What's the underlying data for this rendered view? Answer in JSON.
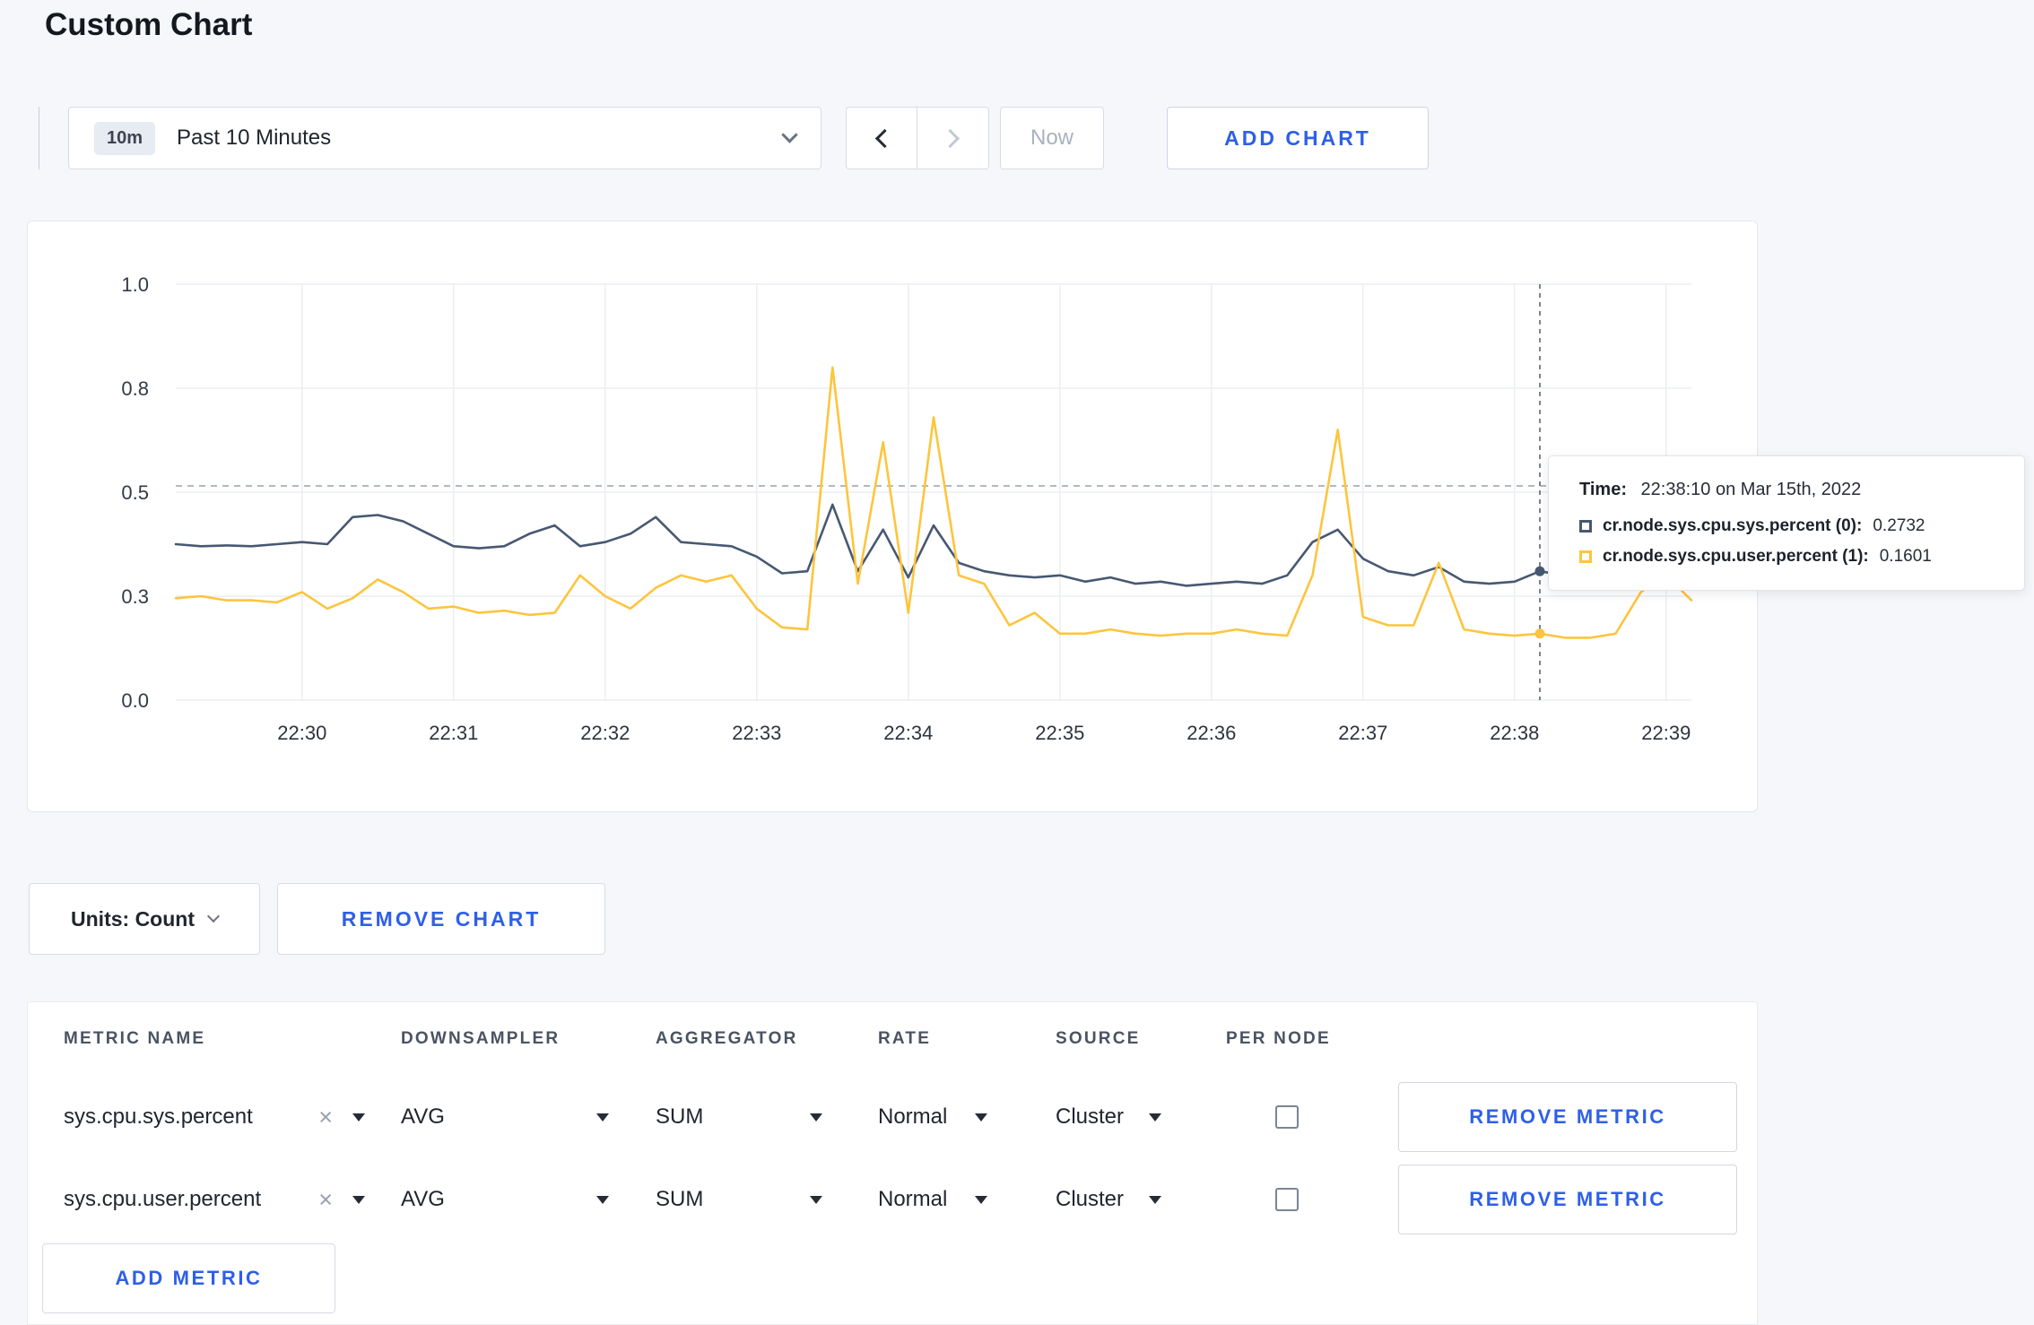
{
  "page": {
    "title": "Custom Chart"
  },
  "colors": {
    "accent": "#2e5fe8",
    "series_sys": "#475872",
    "series_user": "#fdc53d",
    "page_background": "#f6f7fa"
  },
  "toolbar": {
    "time_window": {
      "badge": "10m",
      "label": "Past 10 Minutes"
    },
    "prev_icon": "chevron-left",
    "next_icon": "chevron-right",
    "now_label": "Now",
    "add_chart_label": "ADD CHART"
  },
  "chart": {
    "tooltip": {
      "time_label": "Time:",
      "time_value": "22:38:10 on Mar 15th, 2022",
      "series": [
        {
          "name": "cr.node.sys.cpu.sys.percent (0):",
          "value": "0.2732",
          "color": "#475872"
        },
        {
          "name": "cr.node.sys.cpu.user.percent (1):",
          "value": "0.1601",
          "color": "#fdc53d"
        }
      ]
    }
  },
  "chart_data": {
    "type": "line",
    "title": "",
    "xlabel": "",
    "ylabel": "",
    "ylim": [
      0,
      1
    ],
    "grid": true,
    "y_ticks": [
      {
        "value": 0,
        "label": "0.0"
      },
      {
        "value": 0.25,
        "label": "0.3"
      },
      {
        "value": 0.5,
        "label": "0.5"
      },
      {
        "value": 0.75,
        "label": "0.8"
      },
      {
        "value": 1,
        "label": "1.0"
      }
    ],
    "x_domain_seconds": 600,
    "point_interval_seconds": 10,
    "x_ticks": [
      {
        "offset_s": 50,
        "label": "22:30"
      },
      {
        "offset_s": 110,
        "label": "22:31"
      },
      {
        "offset_s": 170,
        "label": "22:32"
      },
      {
        "offset_s": 230,
        "label": "22:33"
      },
      {
        "offset_s": 290,
        "label": "22:34"
      },
      {
        "offset_s": 350,
        "label": "22:35"
      },
      {
        "offset_s": 410,
        "label": "22:36"
      },
      {
        "offset_s": 470,
        "label": "22:37"
      },
      {
        "offset_s": 530,
        "label": "22:38"
      },
      {
        "offset_s": 590,
        "label": "22:39"
      }
    ],
    "hline_value": 0.515,
    "crosshair": {
      "index": 54,
      "time_label": "22:38:10"
    },
    "series": [
      {
        "name": "cr.node.sys.cpu.sys.percent",
        "color": "#475872",
        "values": [
          0.375,
          0.37,
          0.372,
          0.37,
          0.375,
          0.38,
          0.375,
          0.44,
          0.445,
          0.43,
          0.4,
          0.37,
          0.365,
          0.37,
          0.4,
          0.42,
          0.37,
          0.38,
          0.4,
          0.44,
          0.38,
          0.375,
          0.37,
          0.345,
          0.305,
          0.31,
          0.47,
          0.31,
          0.41,
          0.295,
          0.42,
          0.33,
          0.31,
          0.3,
          0.295,
          0.3,
          0.285,
          0.295,
          0.28,
          0.285,
          0.275,
          0.28,
          0.285,
          0.28,
          0.3,
          0.38,
          0.41,
          0.34,
          0.31,
          0.3,
          0.32,
          0.285,
          0.28,
          0.285,
          0.31,
          0.3,
          0.295,
          0.3,
          0.31,
          0.3,
          0.305
        ]
      },
      {
        "name": "cr.node.sys.cpu.user.percent",
        "color": "#fdc53d",
        "values": [
          0.245,
          0.25,
          0.24,
          0.24,
          0.235,
          0.26,
          0.22,
          0.245,
          0.29,
          0.26,
          0.22,
          0.225,
          0.21,
          0.215,
          0.205,
          0.21,
          0.3,
          0.25,
          0.22,
          0.27,
          0.3,
          0.285,
          0.3,
          0.22,
          0.175,
          0.17,
          0.8,
          0.28,
          0.62,
          0.21,
          0.68,
          0.3,
          0.28,
          0.18,
          0.21,
          0.16,
          0.16,
          0.17,
          0.16,
          0.155,
          0.16,
          0.16,
          0.17,
          0.16,
          0.155,
          0.3,
          0.65,
          0.2,
          0.18,
          0.18,
          0.33,
          0.17,
          0.16,
          0.155,
          0.16,
          0.15,
          0.15,
          0.16,
          0.26,
          0.3,
          0.24
        ]
      }
    ],
    "legend_position": "tooltip-only"
  },
  "units_bar": {
    "units_label": "Units: Count",
    "remove_chart_label": "REMOVE CHART"
  },
  "metrics_table": {
    "headers": [
      "METRIC NAME",
      "DOWNSAMPLER",
      "AGGREGATOR",
      "RATE",
      "SOURCE",
      "PER NODE"
    ],
    "rows": [
      {
        "metric": "sys.cpu.sys.percent",
        "downsampler": "AVG",
        "aggregator": "SUM",
        "rate": "Normal",
        "source": "Cluster",
        "per_node_checked": false,
        "remove_label": "REMOVE METRIC"
      },
      {
        "metric": "sys.cpu.user.percent",
        "downsampler": "AVG",
        "aggregator": "SUM",
        "rate": "Normal",
        "source": "Cluster",
        "per_node_checked": false,
        "remove_label": "REMOVE METRIC"
      }
    ],
    "add_metric_label": "ADD METRIC"
  }
}
